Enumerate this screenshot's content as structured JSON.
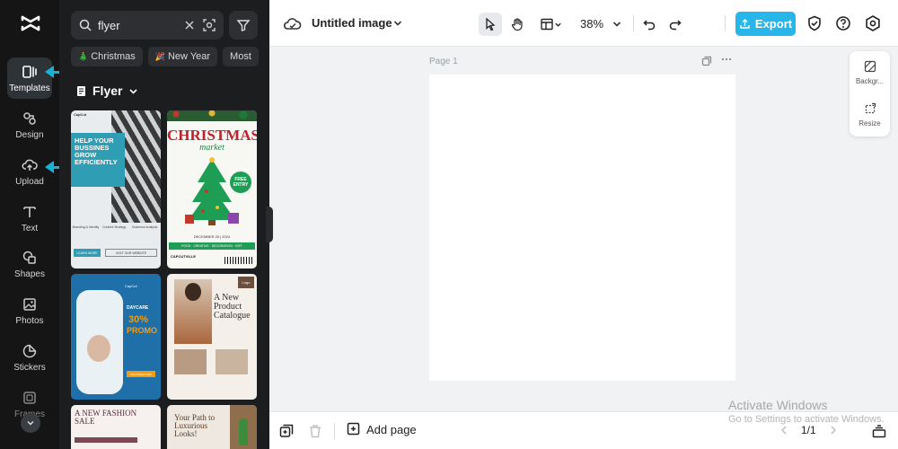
{
  "sidebar": {
    "logo": "capcut-logo",
    "items": [
      {
        "label": "Templates",
        "icon": "templates-icon"
      },
      {
        "label": "Design",
        "icon": "design-icon"
      },
      {
        "label": "Upload",
        "icon": "upload-icon"
      },
      {
        "label": "Text",
        "icon": "text-icon"
      },
      {
        "label": "Shapes",
        "icon": "shapes-icon"
      },
      {
        "label": "Photos",
        "icon": "photos-icon"
      },
      {
        "label": "Stickers",
        "icon": "stickers-icon"
      },
      {
        "label": "Frames",
        "icon": "frames-icon"
      }
    ]
  },
  "panel": {
    "search_value": "flyer",
    "chips": [
      {
        "label": "Christmas",
        "emoji": "🎄"
      },
      {
        "label": "New Year",
        "emoji": "🎉"
      },
      {
        "label": "Most"
      }
    ],
    "category": "Flyer",
    "templates": {
      "t1": {
        "brand": "CapCut",
        "headline": "HELP YOUR BUSSINES GROW EFFICIENTLY",
        "features": [
          "Branding & Identity",
          "Content Strategy",
          "Business Analysis"
        ],
        "button_1": "LEARN MORE",
        "button_2": "VISIT OUR WEBSITE"
      },
      "t2": {
        "title": "CHRISTMAS",
        "subtitle": "market",
        "badge": "FREE ENTRY",
        "date": "DECEMBER 25 | 2024",
        "strip": "FOOD · CREATIVE · DECORATION · GIFT",
        "footer": "CAPCUTVILLE"
      },
      "t3": {
        "brand": "CapCut",
        "label": "DAYCARE",
        "percent": "30%",
        "promo": "PROMO",
        "button": "REGISTER NOW"
      },
      "t4": {
        "title": "A New Product Catalogue",
        "badge": "Logo"
      },
      "t5": {
        "title": "A NEW FASHION SALE"
      },
      "t6": {
        "title": "Your Path to Luxurious Looks!"
      }
    }
  },
  "topbar": {
    "title": "Untitled image",
    "zoom": "38%",
    "export_label": "Export"
  },
  "canvas": {
    "page_label": "Page 1",
    "background_color": "#ffffff"
  },
  "side_tools": [
    {
      "label": "Backgr...",
      "icon": "background-icon"
    },
    {
      "label": "Resize",
      "icon": "resize-icon"
    }
  ],
  "watermark": {
    "line1": "Activate Windows",
    "line2": "Go to Settings to activate Windows."
  },
  "bottombar": {
    "add_page_label": "Add page",
    "page_counter": "1/1"
  },
  "colors": {
    "accent": "#27b6e9",
    "rail_bg": "#151515",
    "panel_bg": "#1c1d1f",
    "annotation_arrow": "#17b2d6"
  }
}
